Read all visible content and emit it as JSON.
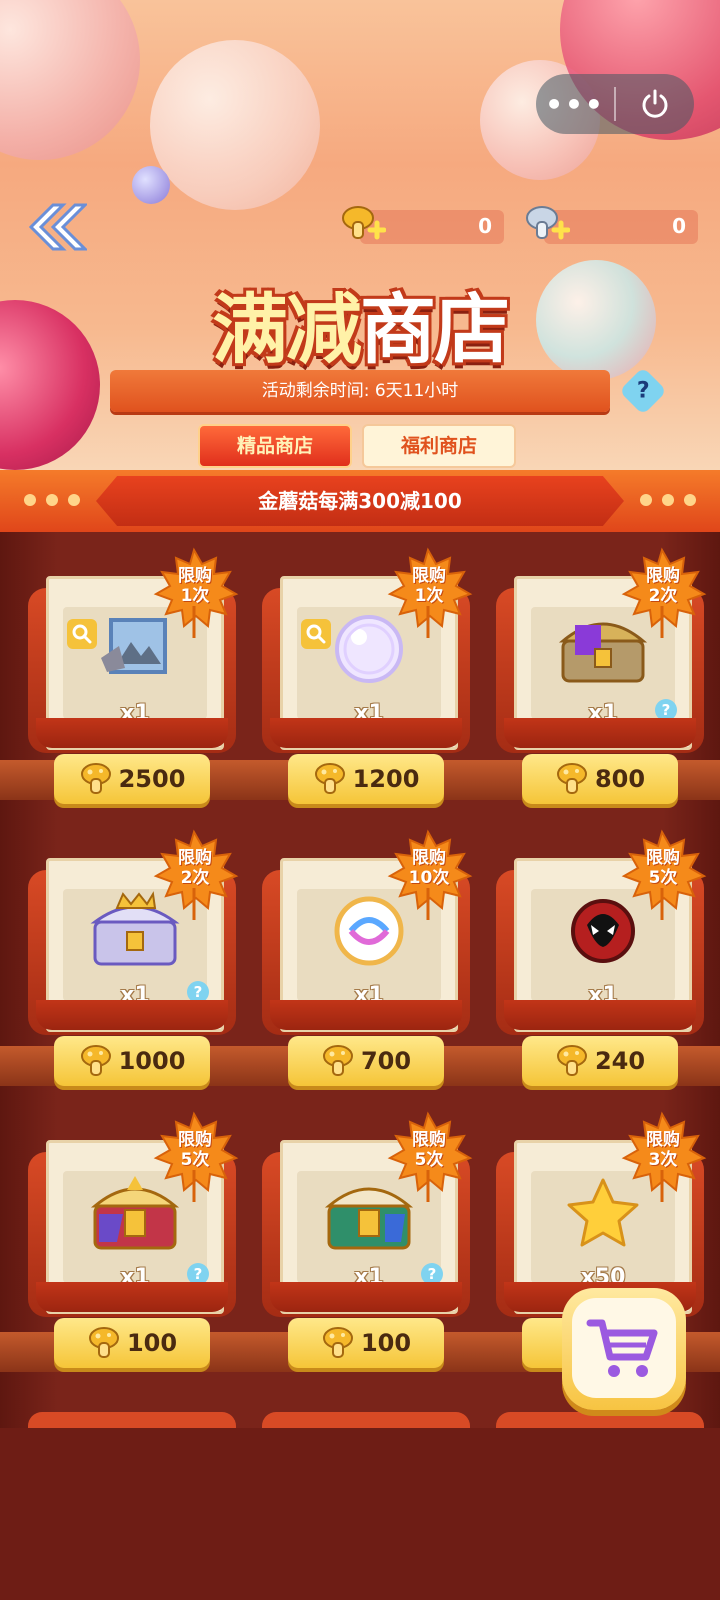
{
  "header": {
    "capsule_more": "•••",
    "title_part1": "满减",
    "title_part2": "商店",
    "countdown": "活动剩余时间: 6天11小时",
    "help": "?",
    "currencies": [
      {
        "name": "gold-mushroom",
        "value": "0"
      },
      {
        "name": "silver-mushroom",
        "value": "0"
      }
    ],
    "tabs": [
      {
        "label": "精品商店",
        "active": true
      },
      {
        "label": "福利商店",
        "active": false
      }
    ]
  },
  "promo": {
    "text": "金蘑菇每满300减100"
  },
  "items": [
    {
      "limit_line1": "限购",
      "limit_line2": "1次",
      "qty": "x1",
      "price": "2500",
      "icon": "painting-icon",
      "has_magnifier": true,
      "has_help": false
    },
    {
      "limit_line1": "限购",
      "limit_line2": "1次",
      "qty": "x1",
      "price": "1200",
      "icon": "bubble-icon",
      "has_magnifier": true,
      "has_help": false
    },
    {
      "limit_line1": "限购",
      "limit_line2": "2次",
      "qty": "x1",
      "price": "800",
      "icon": "purple-chest-icon",
      "has_magnifier": false,
      "has_help": true
    },
    {
      "limit_line1": "限购",
      "limit_line2": "2次",
      "qty": "x1",
      "price": "1000",
      "icon": "crown-chest-icon",
      "has_magnifier": false,
      "has_help": true
    },
    {
      "limit_line1": "限购",
      "limit_line2": "10次",
      "qty": "x1",
      "price": "700",
      "icon": "swirl-orb-icon",
      "has_magnifier": false,
      "has_help": false
    },
    {
      "limit_line1": "限购",
      "limit_line2": "5次",
      "qty": "x1",
      "price": "240",
      "icon": "venom-badge-icon",
      "has_magnifier": false,
      "has_help": false
    },
    {
      "limit_line1": "限购",
      "limit_line2": "5次",
      "qty": "x1",
      "price": "100",
      "icon": "red-chest-icon",
      "has_magnifier": false,
      "has_help": true
    },
    {
      "limit_line1": "限购",
      "limit_line2": "5次",
      "qty": "x1",
      "price": "100",
      "icon": "green-chest-icon",
      "has_magnifier": false,
      "has_help": true
    },
    {
      "limit_line1": "限购",
      "limit_line2": "3次",
      "qty": "x50",
      "price": "",
      "icon": "star-icon",
      "has_magnifier": false,
      "has_help": false
    }
  ],
  "colors": {
    "accent": "#e0461a",
    "gold": "#f5c538",
    "shop_bg": "#7a241a"
  }
}
